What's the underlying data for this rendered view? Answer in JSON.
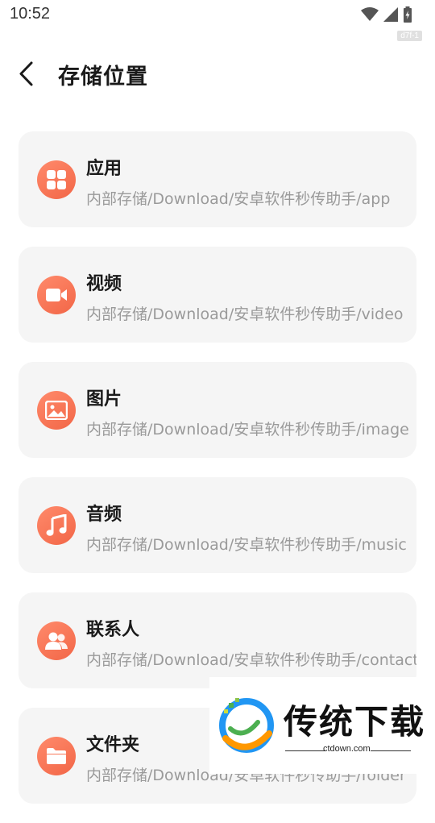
{
  "status_bar": {
    "time": "10:52",
    "icons": [
      "wifi-icon",
      "signal-icon",
      "battery-charging-icon"
    ]
  },
  "build_tag": "d7f-1",
  "header": {
    "title": "存储位置",
    "back_icon": "chevron-left-icon"
  },
  "accent_color": "#f26647",
  "items": [
    {
      "title": "应用",
      "path": "内部存储/Download/安卓软件秒传助手/app",
      "icon": "apps-grid-icon"
    },
    {
      "title": "视频",
      "path": "内部存储/Download/安卓软件秒传助手/video",
      "icon": "video-camera-icon"
    },
    {
      "title": "图片",
      "path": "内部存储/Download/安卓软件秒传助手/image",
      "icon": "image-icon"
    },
    {
      "title": "音频",
      "path": "内部存储/Download/安卓软件秒传助手/music",
      "icon": "music-note-icon"
    },
    {
      "title": "联系人",
      "path": "内部存储/Download/安卓软件秒传助手/contact",
      "icon": "contacts-icon"
    },
    {
      "title": "文件夹",
      "path": "内部存储/Download/安卓软件秒传助手/folder",
      "icon": "folder-icon"
    }
  ],
  "watermark": {
    "brand": "传统下载",
    "url": "ctdown.com"
  }
}
